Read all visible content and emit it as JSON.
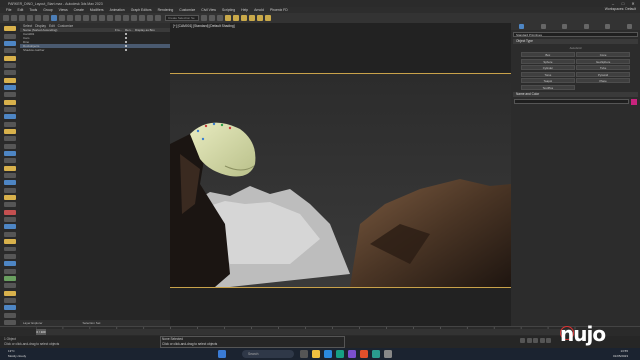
{
  "window": {
    "title": "PARKER_DINO_Layout_Start.max - Autodesk 3ds Max 2023",
    "controls": [
      "–",
      "□",
      "✕"
    ]
  },
  "menubar": {
    "items": [
      "File",
      "Edit",
      "Tools",
      "Group",
      "Views",
      "Create",
      "Modifiers",
      "Animation",
      "Graph Editors",
      "Rendering",
      "Customize",
      "Civil View",
      "Scripting",
      "Help",
      "Arnold",
      "Phoenix FD"
    ],
    "workspace": "Workspaces: Default"
  },
  "toolbar": {
    "selection_set": "Create Selection Se",
    "icons": [
      "undo-icon",
      "redo-icon",
      "link-icon",
      "unlink-icon",
      "bind-icon",
      "filter-icon",
      "select-icon",
      "select-name-icon",
      "region-icon",
      "window-icon",
      "move-icon",
      "rotate-icon",
      "scale-icon",
      "place-icon",
      "view-icon",
      "pivot-icon",
      "snap-icon",
      "angle-snap-icon",
      "percent-snap-icon",
      "spinner-snap-icon",
      "mirror-icon",
      "align-icon",
      "layer-icon",
      "curve-icon",
      "schematic-icon",
      "material-icon",
      "render-setup-icon",
      "render-frame-icon",
      "render-icon"
    ]
  },
  "scene_explorer": {
    "tabs": [
      "Select",
      "Display",
      "Edit",
      "Customize"
    ],
    "columns": [
      "Name (Sorted Ascending)",
      "Fro...",
      "Ren...",
      "Display as Box"
    ],
    "rows": [
      {
        "name": "Cam001",
        "selected": false
      },
      {
        "name": "Cam",
        "selected": false
      },
      {
        "name": "Dino",
        "selected": false
      },
      {
        "name": "Rockobjects",
        "selected": true
      },
      {
        "name": "Shadow catcher",
        "selected": false
      }
    ],
    "footer": "Layer Explorer",
    "selection_set_label": "Selection Set:"
  },
  "viewport": {
    "label": "[+] [CAM001] [Standard] [Default Shading]"
  },
  "command_panel": {
    "dropdown": "Standard Primitives",
    "object_type_header": "Object Type",
    "autogrid": "AutoGrid",
    "buttons": [
      "Box",
      "Cone",
      "Sphere",
      "GeoSphere",
      "Cylinder",
      "Tube",
      "Torus",
      "Pyramid",
      "Teapot",
      "Plane",
      "TextPlus"
    ],
    "name_color_header": "Name and Color",
    "color": "#c8237d"
  },
  "timeline": {
    "slider": "0 / 100",
    "progress": 0.0
  },
  "status": {
    "selected": "None Selected",
    "hint": "Click or click-and-drag to select objects",
    "objects_count": "1 Object",
    "hint2": "Click or click-and-drag to select objects"
  },
  "taskbar": {
    "temperature": "13°C",
    "weather": "Mostly cloudy",
    "search_placeholder": "Search",
    "time": "13:55",
    "date": "01/05/2023"
  },
  "watermark": "nujo"
}
